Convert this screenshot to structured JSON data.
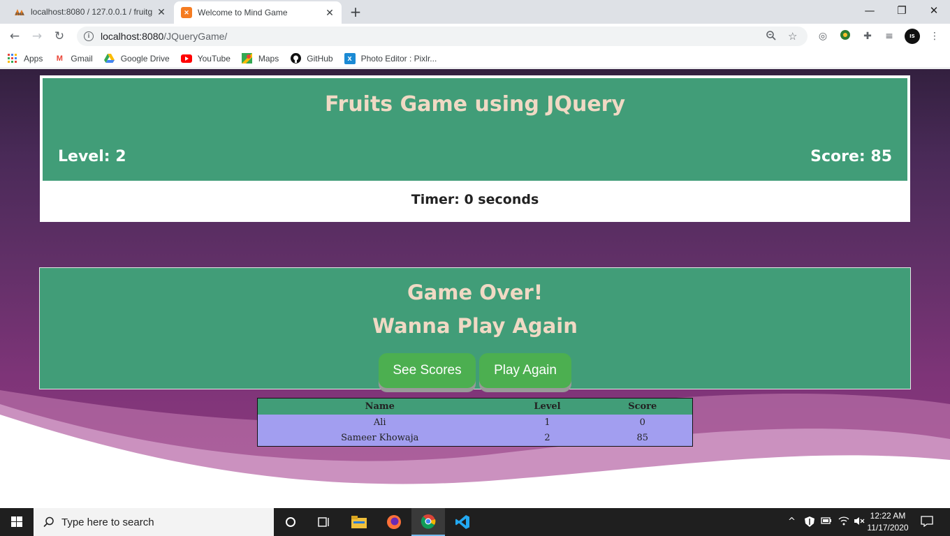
{
  "browser": {
    "tabs": [
      {
        "title": "localhost:8080 / 127.0.0.1 / fruitg",
        "favicon": "phpmyadmin-icon",
        "active": false
      },
      {
        "title": "Welcome to Mind Game",
        "favicon": "xampp-icon",
        "active": true
      }
    ],
    "url_host": "localhost:8080",
    "url_path": "/JQueryGame/",
    "bookmarks": [
      {
        "label": "Apps",
        "icon": "apps-grid-icon"
      },
      {
        "label": "Gmail",
        "icon": "gmail-icon"
      },
      {
        "label": "Google Drive",
        "icon": "google-drive-icon"
      },
      {
        "label": "YouTube",
        "icon": "youtube-icon"
      },
      {
        "label": "Maps",
        "icon": "maps-icon"
      },
      {
        "label": "GitHub",
        "icon": "github-icon"
      },
      {
        "label": "Photo Editor : Pixlr...",
        "icon": "pixlr-icon"
      }
    ]
  },
  "game": {
    "title": "Fruits Game using JQuery",
    "level_text": "Level: 2",
    "score_text": "Score: 85",
    "timer_text": "Timer: 0 seconds",
    "gameover_text": "Game Over!",
    "play_again_prompt": "Wanna Play Again",
    "see_scores_label": "See Scores",
    "play_again_label": "Play Again"
  },
  "scores": {
    "headers": [
      "Name",
      "Level",
      "Score"
    ],
    "rows": [
      [
        "Ali",
        "1",
        "0"
      ],
      [
        "Sameer Khowaja",
        "2",
        "85"
      ]
    ]
  },
  "taskbar": {
    "search_placeholder": "Type here to search",
    "time": "12:22 AM",
    "date": "11/17/2020"
  },
  "colors": {
    "panel_green": "#419d78",
    "table_row": "#a29ef0",
    "button_green": "#4caf50",
    "title_text": "#f0d9c4"
  }
}
